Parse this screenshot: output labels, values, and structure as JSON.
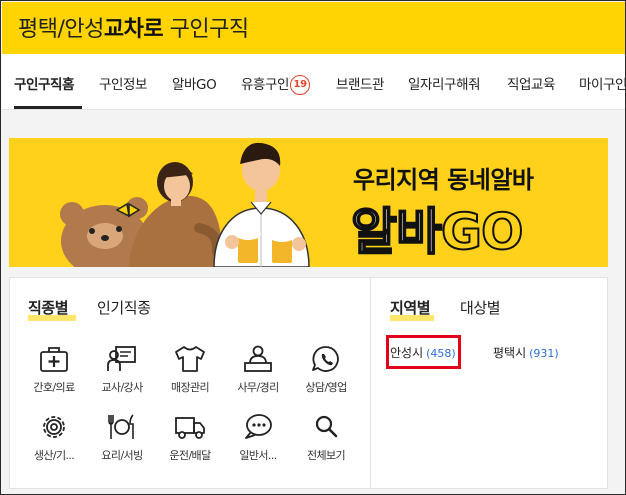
{
  "header": {
    "title_prefix": "평택/안성",
    "title_bold": "교차로",
    "title_suffix": " 구인구직"
  },
  "nav": {
    "items": [
      {
        "label": "구인구직홈",
        "active": true
      },
      {
        "label": "구인정보"
      },
      {
        "label": "알바GO"
      },
      {
        "label": "유흥구인",
        "badge": "19"
      },
      {
        "label": "브랜드관"
      },
      {
        "label": "일자리구해줘"
      },
      {
        "label": "직업교육"
      },
      {
        "label": "마이구인"
      }
    ]
  },
  "banner": {
    "line1": "우리지역 동네알바",
    "line2_a": "알바",
    "line2_b": "GO"
  },
  "jobs_panel": {
    "tab_active": "직종별",
    "tab_inactive": "인기직종",
    "categories": [
      {
        "label": "간호/의료",
        "icon": "medical-kit-icon"
      },
      {
        "label": "교사/강사",
        "icon": "teacher-board-icon"
      },
      {
        "label": "매장관리",
        "icon": "shirt-icon"
      },
      {
        "label": "사무/경리",
        "icon": "office-worker-icon"
      },
      {
        "label": "상담/영업",
        "icon": "phone-chat-icon"
      },
      {
        "label": "생산/기...",
        "icon": "gear-icon"
      },
      {
        "label": "요리/서빙",
        "icon": "dining-icon"
      },
      {
        "label": "운전/배달",
        "icon": "truck-icon"
      },
      {
        "label": "일반서...",
        "icon": "chat-bubble-icon"
      },
      {
        "label": "전체보기",
        "icon": "search-icon"
      }
    ]
  },
  "region_panel": {
    "tab_active": "지역별",
    "tab_inactive": "대상별",
    "regions": [
      {
        "name": "안성시",
        "count": "(458)"
      },
      {
        "name": "평택시",
        "count": "(931)"
      }
    ]
  },
  "colors": {
    "brand_yellow": "#ffd400",
    "highlight_red": "#e3001b",
    "count_blue": "#2d6fd2",
    "badge_red": "#e8452c"
  }
}
